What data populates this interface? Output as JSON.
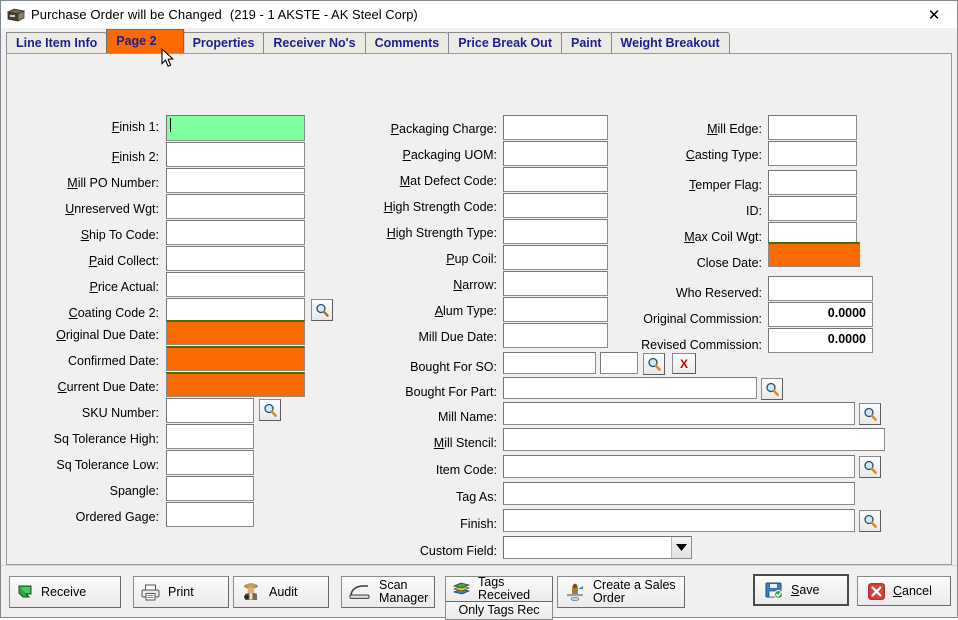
{
  "window": {
    "icon": "po-box-icon",
    "title": "Purchase Order will be Changed",
    "subtitle": "(219 - 1  AKSTE - AK Steel Corp)",
    "close_label": "✕"
  },
  "tabs": [
    {
      "label": "Line Item Info",
      "active": false
    },
    {
      "label": "Page 2",
      "active": true
    },
    {
      "label": "Properties",
      "active": false
    },
    {
      "label": "Receiver No's",
      "active": false
    },
    {
      "label": "Comments",
      "active": false
    },
    {
      "label": "Price Break Out",
      "active": false
    },
    {
      "label": "Paint",
      "active": false
    },
    {
      "label": "Weight Breakout",
      "active": false
    }
  ],
  "colors": {
    "tab_active_bg": "#f96a00",
    "tab_text": "#1f1f8f",
    "field_highlight_green": "#80ff9f",
    "field_highlight_orange": "#f96a00",
    "panel_bg": "#f0f0f0"
  },
  "column_left": [
    {
      "label": "Finish 1:",
      "accel": "F",
      "value": "",
      "state": "focused-green"
    },
    {
      "label": "Finish 2:",
      "accel": "F",
      "value": "",
      "state": "normal"
    },
    {
      "label": "Mill PO Number:",
      "accel": "M",
      "value": "",
      "state": "normal"
    },
    {
      "label": "Unreserved Wgt:",
      "accel": "U",
      "value": "",
      "state": "normal"
    },
    {
      "label": "Ship To Code:",
      "accel": "S",
      "value": "",
      "state": "normal"
    },
    {
      "label": "Paid Collect:",
      "accel": "P",
      "value": "",
      "state": "normal"
    },
    {
      "label": "Price Actual:",
      "accel": "P",
      "value": "",
      "state": "normal"
    },
    {
      "label": "Coating Code 2:",
      "accel": "C",
      "value": "",
      "state": "normal",
      "lookup": true
    },
    {
      "label": "Original Due Date:",
      "accel": "O",
      "value": "",
      "state": "orange"
    },
    {
      "label": "Confirmed Date:",
      "accel": "",
      "value": "",
      "state": "orange"
    },
    {
      "label": "Current Due Date:",
      "accel": "C",
      "value": "",
      "state": "orange"
    },
    {
      "label": "SKU Number:",
      "accel": "",
      "value": "",
      "state": "normal",
      "lookup": true
    },
    {
      "label": "Sq Tolerance High:",
      "accel": "",
      "value": "",
      "state": "normal"
    },
    {
      "label": "Sq Tolerance Low:",
      "accel": "",
      "value": "",
      "state": "normal"
    },
    {
      "label": "Spangle:",
      "accel": "",
      "value": "",
      "state": "normal"
    },
    {
      "label": "Ordered Gage:",
      "accel": "",
      "value": "",
      "state": "normal"
    }
  ],
  "column_mid": [
    {
      "label": "Packaging Charge:",
      "accel": "P",
      "value": ""
    },
    {
      "label": "Packaging UOM:",
      "accel": "P",
      "value": ""
    },
    {
      "label": "Mat Defect Code:",
      "accel": "M",
      "value": ""
    },
    {
      "label": "High Strength Code:",
      "accel": "H",
      "value": ""
    },
    {
      "label": "High Strength Type:",
      "accel": "H",
      "value": ""
    },
    {
      "label": "Pup Coil:",
      "accel": "P",
      "value": ""
    },
    {
      "label": "Narrow:",
      "accel": "N",
      "value": ""
    },
    {
      "label": "Alum Type:",
      "accel": "A",
      "value": ""
    },
    {
      "label": "Mill Due Date:",
      "accel": "",
      "value": ""
    },
    {
      "label": "Bought For SO:",
      "accel": "",
      "value": "",
      "value2": "",
      "lookup": true,
      "clear": "X"
    },
    {
      "label": "Bought For Part:",
      "accel": "",
      "value": "",
      "lookup": true
    },
    {
      "label": "Mill Name:",
      "accel": "",
      "value": "",
      "lookup": true
    },
    {
      "label": "Mill Stencil:",
      "accel": "M",
      "value": ""
    },
    {
      "label": "Item Code:",
      "accel": "",
      "value": "",
      "lookup": true
    },
    {
      "label": "Tag As:",
      "accel": "",
      "value": ""
    },
    {
      "label": "Finish:",
      "accel": "",
      "value": "",
      "lookup": true
    },
    {
      "label": "Custom Field:",
      "accel": "",
      "value": "",
      "combo": true
    }
  ],
  "column_right": [
    {
      "label": "Mill Edge:",
      "accel": "M",
      "value": "",
      "state": "normal"
    },
    {
      "label": "Casting Type:",
      "accel": "C",
      "value": "",
      "state": "normal"
    },
    {
      "label": "Temper Flag:",
      "accel": "T",
      "value": "",
      "state": "normal"
    },
    {
      "label": "ID:",
      "accel": "",
      "value": "",
      "state": "normal"
    },
    {
      "label": "Max Coil Wgt:",
      "accel": "M",
      "value": "",
      "state": "normal"
    },
    {
      "label": "Close Date:",
      "accel": "",
      "value": "",
      "state": "orange"
    },
    {
      "label": "Who Reserved:",
      "accel": "",
      "value": "",
      "state": "normal"
    },
    {
      "label": "Original Commission:",
      "accel": "",
      "value": "0.0000",
      "state": "number"
    },
    {
      "label": "Revised Commission:",
      "accel": "",
      "value": "0.0000",
      "state": "number"
    }
  ],
  "toolbar": [
    {
      "name": "receive",
      "label": "Receive",
      "icon": "receive-arrow-icon"
    },
    {
      "name": "print",
      "label": "Print",
      "icon": "printer-icon"
    },
    {
      "name": "audit",
      "label": "Audit",
      "icon": "detective-icon"
    },
    {
      "name": "scan-manager",
      "label": "Scan\nManager",
      "icon": "scanner-icon"
    },
    {
      "name": "tags-received",
      "label": "Tags Received",
      "icon": "books-icon",
      "sublabel": "Only Tags Rec",
      "sub_accel": "O"
    },
    {
      "name": "create-sales-order",
      "label": "Create a Sales\nOrder",
      "icon": "sales-order-icon"
    }
  ],
  "actions": [
    {
      "name": "save",
      "label": "Save",
      "accel": "S",
      "icon": "floppy-save-icon",
      "default": true
    },
    {
      "name": "cancel",
      "label": "Cancel",
      "accel": "C",
      "icon": "red-x-icon",
      "default": false
    }
  ]
}
